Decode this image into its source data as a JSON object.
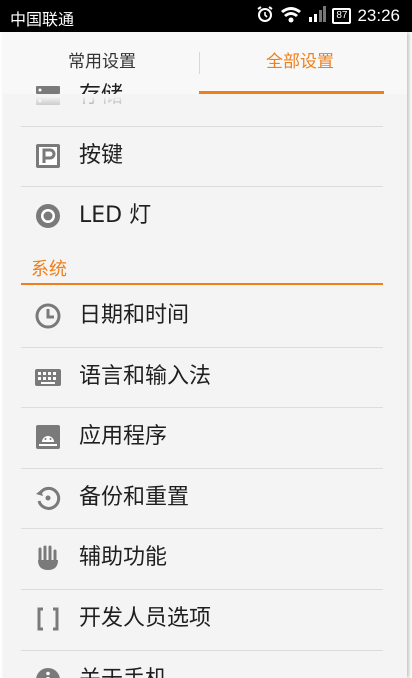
{
  "status_bar": {
    "carrier": "中国联通",
    "battery": "87",
    "time": "23:26"
  },
  "tabs": [
    {
      "label": "常用设置",
      "active": false
    },
    {
      "label": "全部设置",
      "active": true
    }
  ],
  "accent_color": "#ef7f1a",
  "list": {
    "items_before": [
      {
        "label": "存储",
        "icon": "storage-icon"
      },
      {
        "label": "按键",
        "icon": "parking-key-icon"
      },
      {
        "label": "LED 灯",
        "icon": "led-light-icon"
      }
    ],
    "section_header": "系统",
    "system_items": [
      {
        "label": "日期和时间",
        "icon": "clock-icon"
      },
      {
        "label": "语言和输入法",
        "icon": "keyboard-icon"
      },
      {
        "label": "应用程序",
        "icon": "android-app-icon"
      },
      {
        "label": "备份和重置",
        "icon": "backup-restore-icon"
      },
      {
        "label": "辅助功能",
        "icon": "hand-icon"
      },
      {
        "label": "开发人员选项",
        "icon": "brackets-icon"
      },
      {
        "label": "关于手机",
        "icon": "info-icon"
      }
    ]
  }
}
